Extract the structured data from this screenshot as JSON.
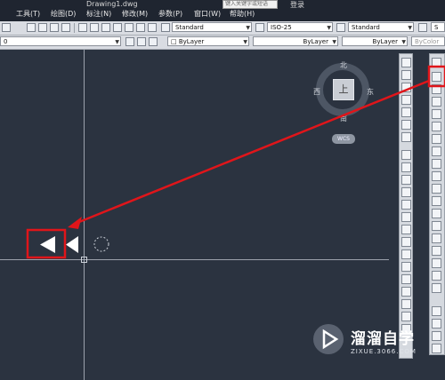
{
  "titlebar": {
    "title": "Drawing1.dwg",
    "search_placeholder": "键入关键字或短语",
    "login_label": "登录"
  },
  "menu": [
    {
      "label": "工具(T)"
    },
    {
      "label": "绘图(D)"
    },
    {
      "label": "标注(N)"
    },
    {
      "label": "修改(M)"
    },
    {
      "label": "参数(P)"
    },
    {
      "label": "窗口(W)"
    },
    {
      "label": "帮助(H)"
    }
  ],
  "styles_toolbar": {
    "text_style": "Standard",
    "dim_style": "ISO-25",
    "table_style": "Standard",
    "multileader_style": "S"
  },
  "layers_toolbar": {
    "layer": "0",
    "color": "ByLayer",
    "linetype": "ByLayer",
    "lineweight": "ByLayer",
    "plotstyle": "ByColor"
  },
  "viewcube": {
    "north": "北",
    "south": "南",
    "west": "西",
    "east": "东",
    "top": "上",
    "ucs_label": "WCS"
  },
  "watermark": {
    "main": "溜溜自学",
    "sub": "ZIXUE.3066.COM"
  },
  "annotation_color": "#e0151a"
}
